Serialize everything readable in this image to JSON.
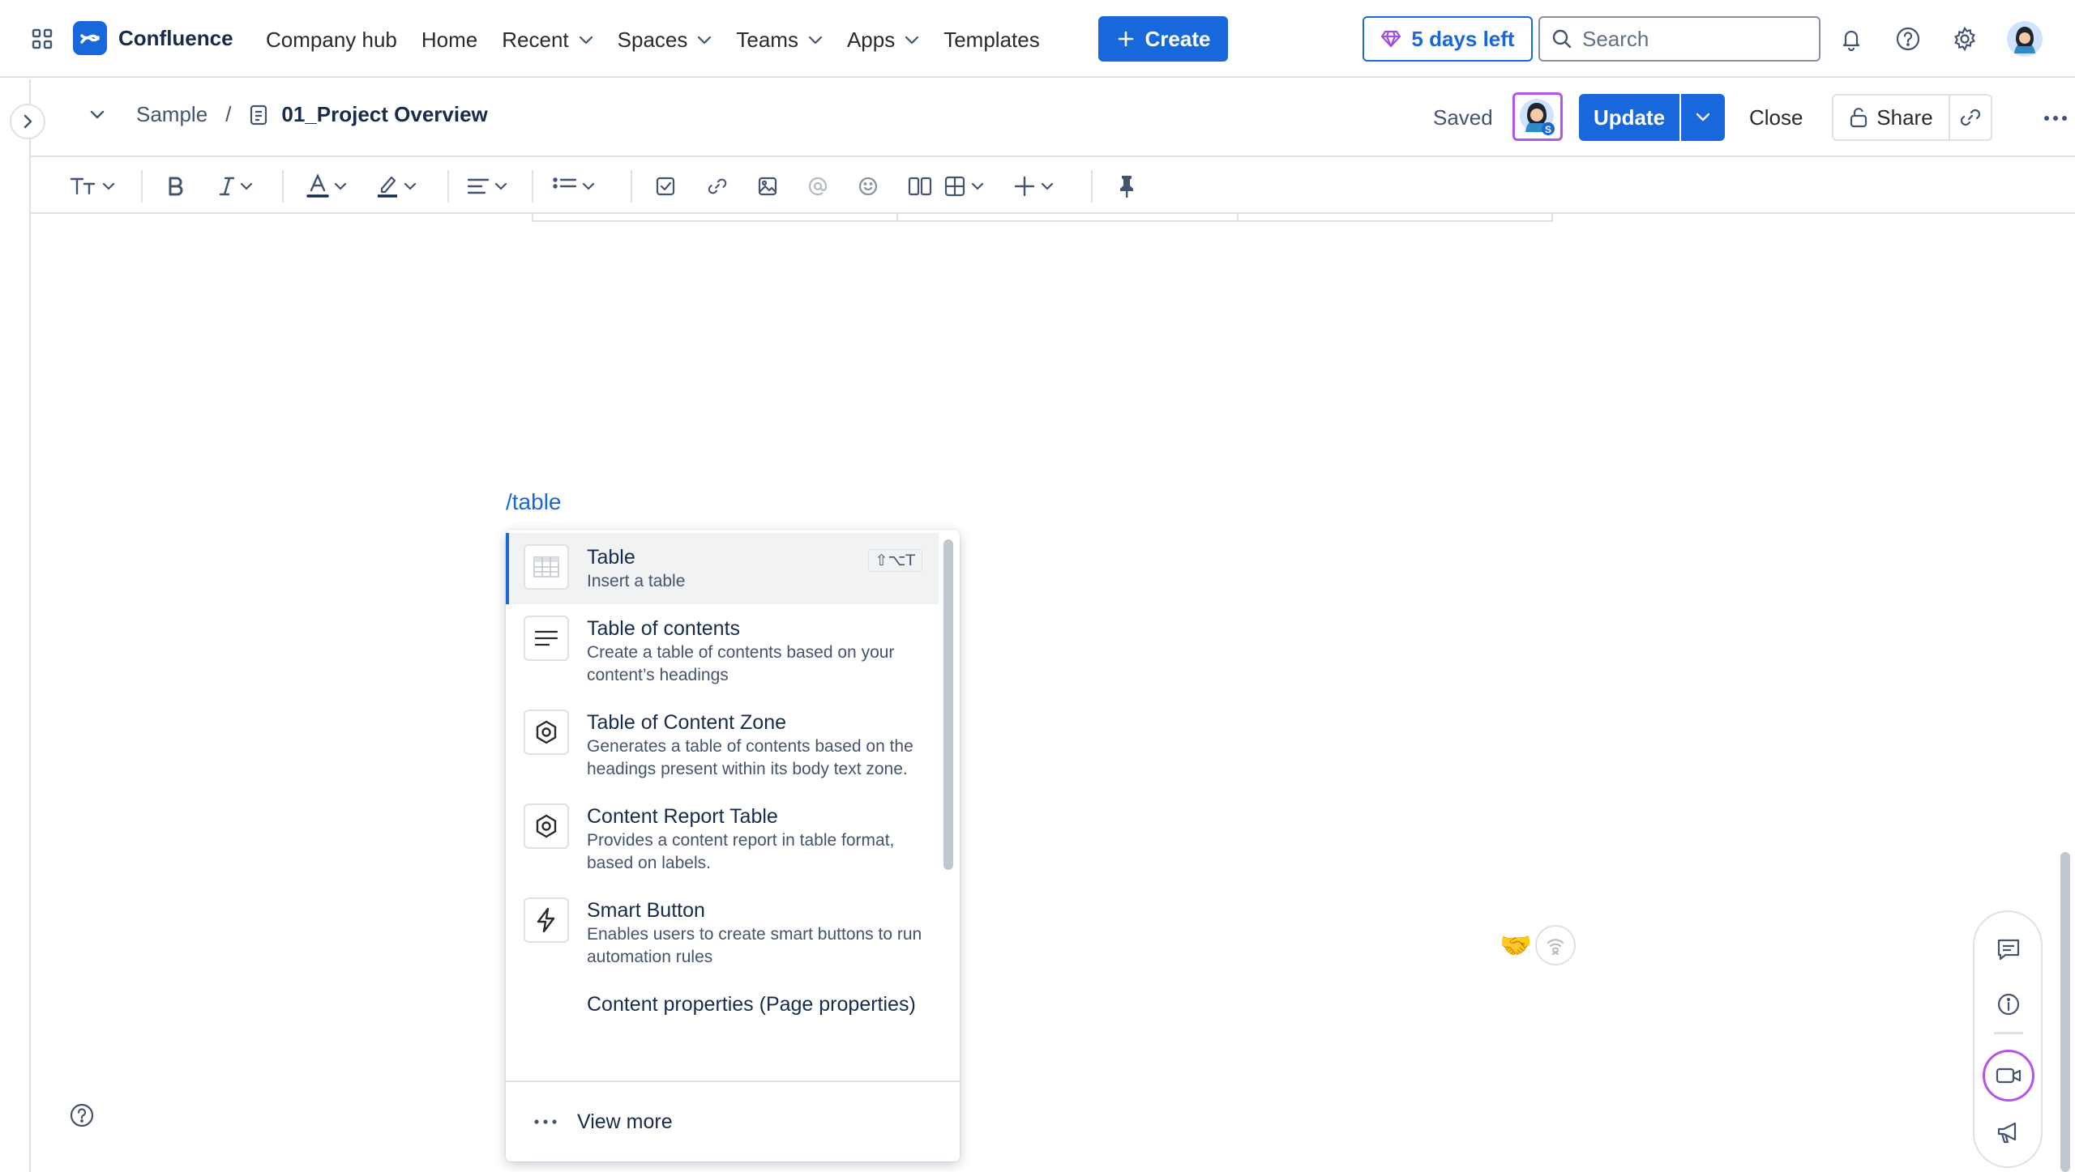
{
  "topnav": {
    "brand": "Confluence",
    "items": [
      {
        "label": "Company hub",
        "has_caret": false
      },
      {
        "label": "Home",
        "has_caret": false
      },
      {
        "label": "Recent",
        "has_caret": true
      },
      {
        "label": "Spaces",
        "has_caret": true
      },
      {
        "label": "Teams",
        "has_caret": true
      },
      {
        "label": "Apps",
        "has_caret": true
      },
      {
        "label": "Templates",
        "has_caret": false
      }
    ],
    "create_label": "Create",
    "trial_label": "5 days left",
    "search_placeholder": "Search",
    "icons": [
      "app-switcher-icon",
      "notifications-icon",
      "help-icon",
      "settings-icon",
      "profile-avatar"
    ]
  },
  "page_header": {
    "space": "Sample",
    "separator": "/",
    "page_title": "01_Project Overview",
    "status": "Saved",
    "update_label": "Update",
    "close_label": "Close",
    "share_label": "Share"
  },
  "editor": {
    "slash_query": "/table"
  },
  "slash_menu": {
    "items": [
      {
        "title": "Table",
        "description": "Insert a table",
        "shortcut": "⇧⌥T",
        "icon": "table-icon",
        "selected": true
      },
      {
        "title": "Table of contents",
        "description": "Create a table of contents based on your content’s headings",
        "shortcut": "",
        "icon": "toc-icon",
        "selected": false
      },
      {
        "title": "Table of Content Zone",
        "description": "Generates a table of contents based on the headings present within its body text zone.",
        "shortcut": "",
        "icon": "hexagon-icon",
        "selected": false
      },
      {
        "title": "Content Report Table",
        "description": "Provides a content report in table format, based on labels.",
        "shortcut": "",
        "icon": "hexagon-icon",
        "selected": false
      },
      {
        "title": "Smart Button",
        "description": "Enables users to create smart buttons to run automation rules",
        "shortcut": "",
        "icon": "lightning-icon",
        "selected": false
      },
      {
        "title": "Content properties (Page properties)",
        "description": "",
        "shortcut": "",
        "icon": "",
        "selected": false
      }
    ],
    "view_more_label": "View more"
  },
  "colors": {
    "accent": "#1868db",
    "border": "#dfe1e6",
    "presence_ring": "#b455e8"
  }
}
